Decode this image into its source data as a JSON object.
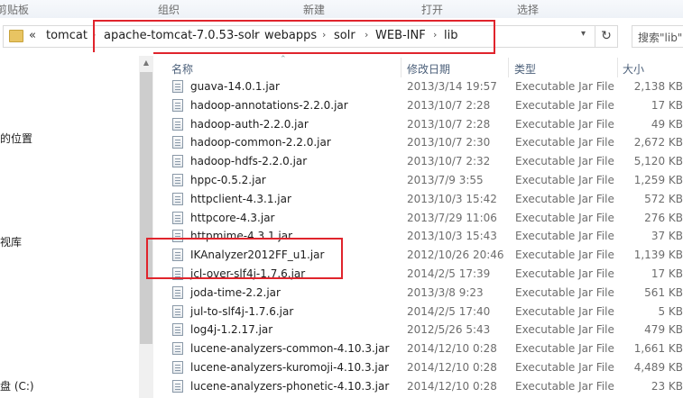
{
  "ribbon": {
    "items": [
      "剪贴板",
      "组织",
      "新建",
      "打开",
      "选择"
    ]
  },
  "address": {
    "back_chevron": "«",
    "crumbs": [
      "tomcat",
      "apache-tomcat-7.0.53-solr",
      "webapps",
      "solr",
      "WEB-INF",
      "lib"
    ],
    "dropdown": "▾",
    "refresh": "↻"
  },
  "search": {
    "placeholder": "搜索\"lib\""
  },
  "nav": {
    "items": [
      "的位置",
      "视库",
      "盘 (C:)"
    ]
  },
  "columns": {
    "name": "名称",
    "date": "修改日期",
    "type": "类型",
    "size": "大小"
  },
  "files": [
    {
      "name": "guava-14.0.1.jar",
      "date": "2013/3/14 19:57",
      "type": "Executable Jar File",
      "size": "2,138 KB"
    },
    {
      "name": "hadoop-annotations-2.2.0.jar",
      "date": "2013/10/7 2:28",
      "type": "Executable Jar File",
      "size": "17 KB"
    },
    {
      "name": "hadoop-auth-2.2.0.jar",
      "date": "2013/10/7 2:28",
      "type": "Executable Jar File",
      "size": "49 KB"
    },
    {
      "name": "hadoop-common-2.2.0.jar",
      "date": "2013/10/7 2:30",
      "type": "Executable Jar File",
      "size": "2,672 KB"
    },
    {
      "name": "hadoop-hdfs-2.2.0.jar",
      "date": "2013/10/7 2:32",
      "type": "Executable Jar File",
      "size": "5,120 KB"
    },
    {
      "name": "hppc-0.5.2.jar",
      "date": "2013/7/9 3:55",
      "type": "Executable Jar File",
      "size": "1,259 KB"
    },
    {
      "name": "httpclient-4.3.1.jar",
      "date": "2013/10/3 15:42",
      "type": "Executable Jar File",
      "size": "572 KB"
    },
    {
      "name": "httpcore-4.3.jar",
      "date": "2013/7/29 11:06",
      "type": "Executable Jar File",
      "size": "276 KB"
    },
    {
      "name": "httpmime-4.3.1.jar",
      "date": "2013/10/3 15:43",
      "type": "Executable Jar File",
      "size": "37 KB"
    },
    {
      "name": "IKAnalyzer2012FF_u1.jar",
      "date": "2012/10/26 20:46",
      "type": "Executable Jar File",
      "size": "1,139 KB"
    },
    {
      "name": "jcl-over-slf4j-1.7.6.jar",
      "date": "2014/2/5 17:39",
      "type": "Executable Jar File",
      "size": "17 KB"
    },
    {
      "name": "joda-time-2.2.jar",
      "date": "2013/3/8 9:23",
      "type": "Executable Jar File",
      "size": "561 KB"
    },
    {
      "name": "jul-to-slf4j-1.7.6.jar",
      "date": "2014/2/5 17:40",
      "type": "Executable Jar File",
      "size": "5 KB"
    },
    {
      "name": "log4j-1.2.17.jar",
      "date": "2012/5/26 5:43",
      "type": "Executable Jar File",
      "size": "479 KB"
    },
    {
      "name": "lucene-analyzers-common-4.10.3.jar",
      "date": "2014/12/10 0:28",
      "type": "Executable Jar File",
      "size": "1,661 KB"
    },
    {
      "name": "lucene-analyzers-kuromoji-4.10.3.jar",
      "date": "2014/12/10 0:28",
      "type": "Executable Jar File",
      "size": "4,489 KB"
    },
    {
      "name": "lucene-analyzers-phonetic-4.10.3.jar",
      "date": "2014/12/10 0:28",
      "type": "Executable Jar File",
      "size": "23 KB"
    }
  ],
  "colors": {
    "highlight": "#e0242c",
    "header_text": "#4c607a"
  }
}
